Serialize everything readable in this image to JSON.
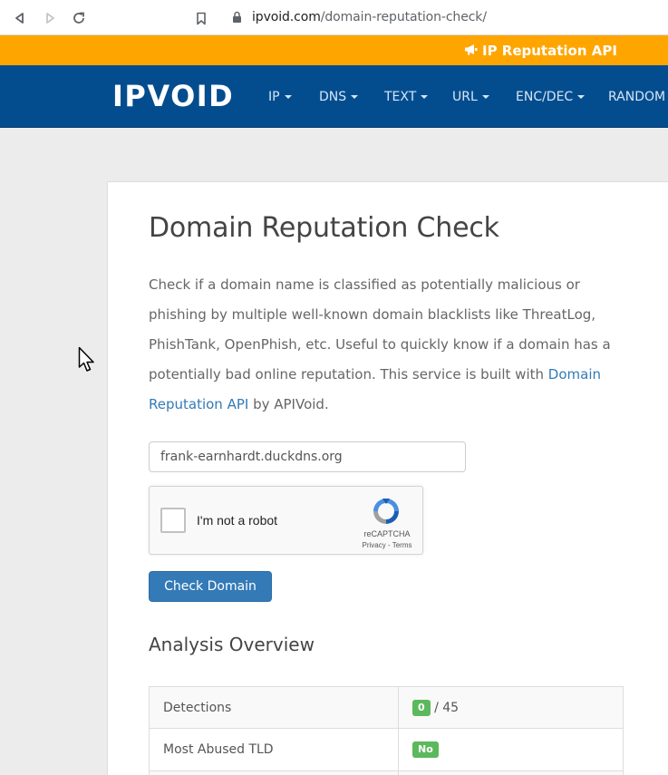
{
  "browser": {
    "url_host": "ipvoid.com",
    "url_path": "/domain-reputation-check/",
    "icons": [
      "back-icon",
      "forward-icon",
      "reload-icon",
      "bookmark-icon",
      "lock-icon"
    ]
  },
  "promo": {
    "label": "IP Reputation API",
    "icon": "bullhorn-icon",
    "background": "#ffa500"
  },
  "navbar": {
    "brand": "IPVOID",
    "background": "#034d8f",
    "menu": [
      {
        "label": "IP",
        "dropdown": true
      },
      {
        "label": "DNS",
        "dropdown": true
      },
      {
        "label": "TEXT",
        "dropdown": true
      },
      {
        "label": "URL",
        "dropdown": true
      },
      {
        "label": "ENC/DEC",
        "dropdown": true
      },
      {
        "label": "RANDOM",
        "dropdown": false
      }
    ]
  },
  "main": {
    "title": "Domain Reputation Check",
    "intro_before_link": "Check if a domain name is classified as potentially malicious or phishing by multiple well-known domain blacklists like ThreatLog, PhishTank, OpenPhish, etc. Useful to quickly know if a domain has a potentially bad online reputation. This service is built with ",
    "intro_link": "Domain Reputation API",
    "intro_after_link": " by APIVoid.",
    "domain_input_value": "frank-earnhardt.duckdns.org",
    "captcha": {
      "label": "I'm not a robot",
      "brand": "reCAPTCHA",
      "terms": "Privacy - Terms"
    },
    "check_button": "Check Domain",
    "analysis_title": "Analysis Overview",
    "results": [
      {
        "key": "Detections",
        "badge": "0",
        "suffix": " / 45"
      },
      {
        "key": "Most Abused TLD",
        "badge": "No",
        "suffix": ""
      }
    ],
    "badge_color": "#5cb85c"
  }
}
